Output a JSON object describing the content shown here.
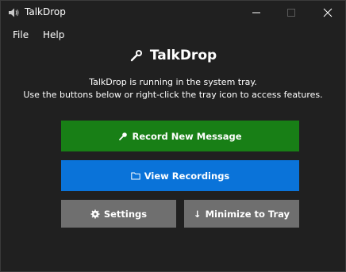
{
  "window": {
    "title": "TalkDrop"
  },
  "menu": {
    "items": [
      "File",
      "Help"
    ]
  },
  "header": {
    "title": "TalkDrop",
    "icon": "microphone-icon"
  },
  "description": {
    "line1": "TalkDrop is running in the system tray.",
    "line2": "Use the buttons below or right-click the tray icon to access features."
  },
  "buttons": {
    "record": {
      "label": "Record New Message",
      "icon": "microphone-icon",
      "color": "#187f16"
    },
    "view": {
      "label": "View Recordings",
      "icon": "folder-icon",
      "color": "#0a73d9"
    },
    "settings": {
      "label": "Settings",
      "icon": "gear-icon",
      "color": "#6f6f6f"
    },
    "minimize": {
      "label": "Minimize to Tray",
      "icon": "arrow-down-icon",
      "glyph": "↓",
      "color": "#6f6f6f"
    }
  }
}
